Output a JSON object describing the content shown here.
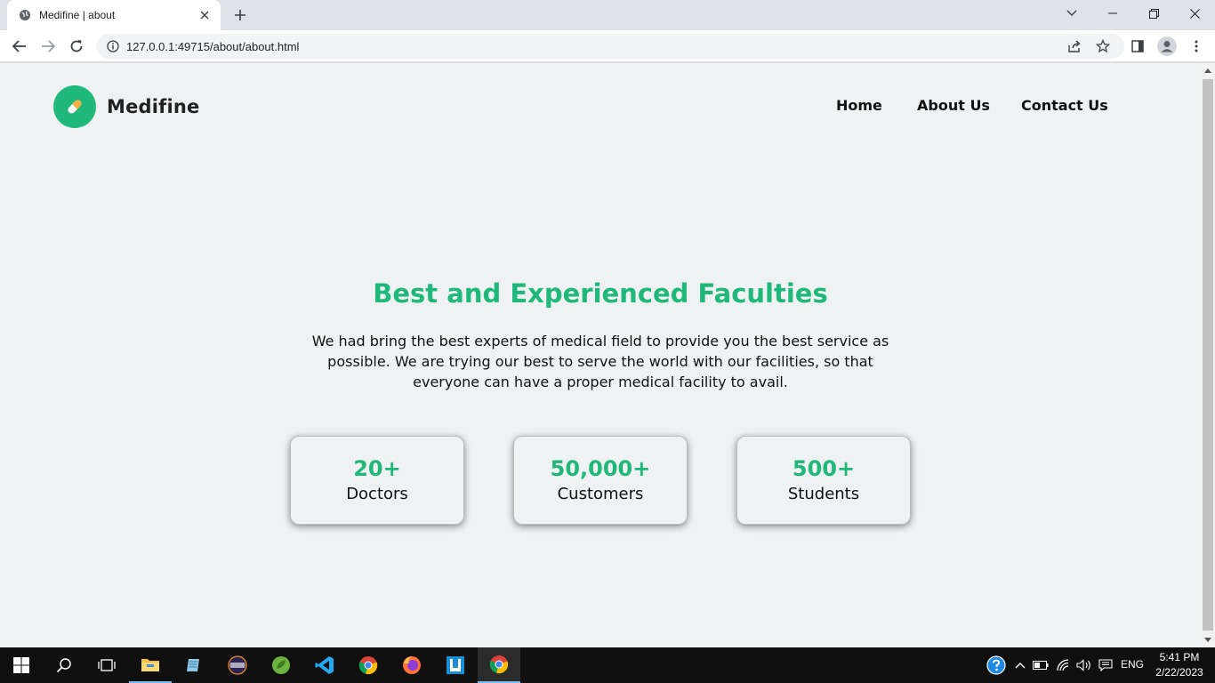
{
  "browser": {
    "tab_title": "Medifine | about",
    "url": "127.0.0.1:49715/about/about.html"
  },
  "site": {
    "brand": "Medifine",
    "nav": [
      "Home",
      "About Us",
      "Contact Us"
    ]
  },
  "hero": {
    "title": "Best and Experienced Faculties",
    "text": "We had bring the best experts of medical field to provide you the best service as possible. We are trying our best to serve the world with our facilities, so that everyone can have a proper medical facility to avail."
  },
  "stats": [
    {
      "value": "20+",
      "label": "Doctors"
    },
    {
      "value": "50,000+",
      "label": "Customers"
    },
    {
      "value": "500+",
      "label": "Students"
    }
  ],
  "taskbar": {
    "language": "ENG",
    "time": "5:41 PM",
    "date": "2/22/2023"
  },
  "colors": {
    "accent": "#1fb87a",
    "page_background": "#eff2f3",
    "text": "#111111"
  }
}
